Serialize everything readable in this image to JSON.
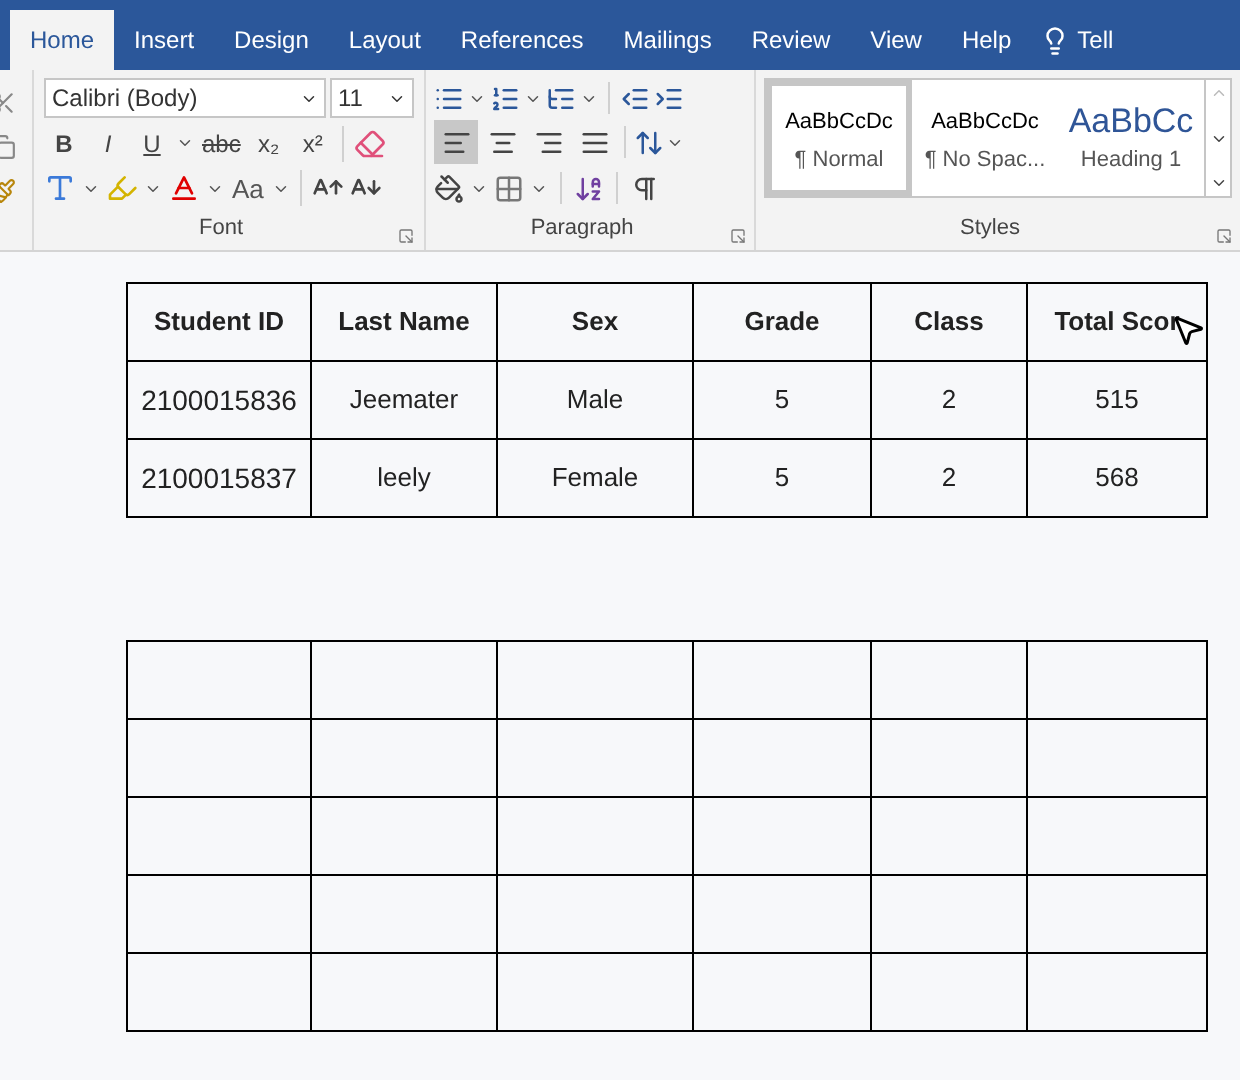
{
  "tabs": [
    {
      "label": "Home",
      "selected": true
    },
    {
      "label": "Insert",
      "selected": false
    },
    {
      "label": "Design",
      "selected": false
    },
    {
      "label": "Layout",
      "selected": false
    },
    {
      "label": "References",
      "selected": false
    },
    {
      "label": "Mailings",
      "selected": false
    },
    {
      "label": "Review",
      "selected": false
    },
    {
      "label": "View",
      "selected": false
    },
    {
      "label": "Help",
      "selected": false
    }
  ],
  "tell_me": {
    "label": "Tell"
  },
  "font": {
    "label": "Font",
    "name": "Calibri (Body)",
    "size": "11",
    "buttons": [
      {
        "kind": "bold",
        "text": "B"
      },
      {
        "kind": "italic",
        "text": "I"
      },
      {
        "kind": "underline",
        "text": "U"
      },
      {
        "kind": "strike",
        "text": "abc"
      },
      {
        "kind": "subscript",
        "text": "x₂"
      },
      {
        "kind": "superscript",
        "text": "x²"
      }
    ],
    "case_button": "Aa"
  },
  "paragraph": {
    "label": "Paragraph",
    "alignments": [
      {
        "kind": "left",
        "selected": true
      },
      {
        "kind": "center",
        "selected": false
      },
      {
        "kind": "right",
        "selected": false
      },
      {
        "kind": "justify",
        "selected": false
      }
    ]
  },
  "styles": {
    "label": "Styles",
    "items": [
      {
        "kind": "body",
        "preview": "AaBbCcDc",
        "name": "¶ Normal",
        "selected": true
      },
      {
        "kind": "body",
        "preview": "AaBbCcDc",
        "name": "¶ No Spac...",
        "selected": false
      },
      {
        "kind": "heading",
        "preview": "AaBbCc",
        "name": "Heading 1",
        "selected": false
      }
    ]
  },
  "table": {
    "columns": [
      "Student ID",
      "Last Name",
      "Sex",
      "Grade",
      "Class",
      "Total Scor"
    ],
    "rows": [
      [
        "2100015836",
        "Jeemater",
        "Male",
        "5",
        "2",
        "515"
      ],
      [
        "2100015837",
        "leely",
        "Female",
        "5",
        "2",
        "568"
      ]
    ]
  }
}
